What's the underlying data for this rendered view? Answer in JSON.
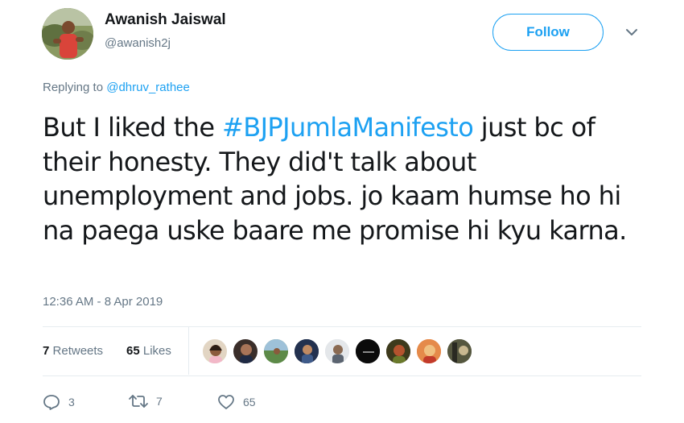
{
  "author": {
    "name": "Awanish Jaiswal",
    "handle": "@awanish2j"
  },
  "follow_label": "Follow",
  "replying": {
    "prefix": "Replying to ",
    "mention": "@dhruv_rathee"
  },
  "tweet": {
    "before": "But I liked the ",
    "hashtag": "#BJPJumlaManifesto",
    "after": " just bc of their honesty. They did't talk about unemployment and jobs. jo kaam humse ho hi na paega uske baare me promise hi kyu karna."
  },
  "timestamp": "12:36 AM - 8 Apr 2019",
  "stats": {
    "retweets_count": "7",
    "retweets_label": "Retweets",
    "likes_count": "65",
    "likes_label": "Likes"
  },
  "actions": {
    "reply_count": "3",
    "retweet_count": "7",
    "like_count": "65"
  },
  "colors": {
    "accent": "#1da1f2",
    "secondary_text": "#657786",
    "divider": "#e6ecf0"
  }
}
